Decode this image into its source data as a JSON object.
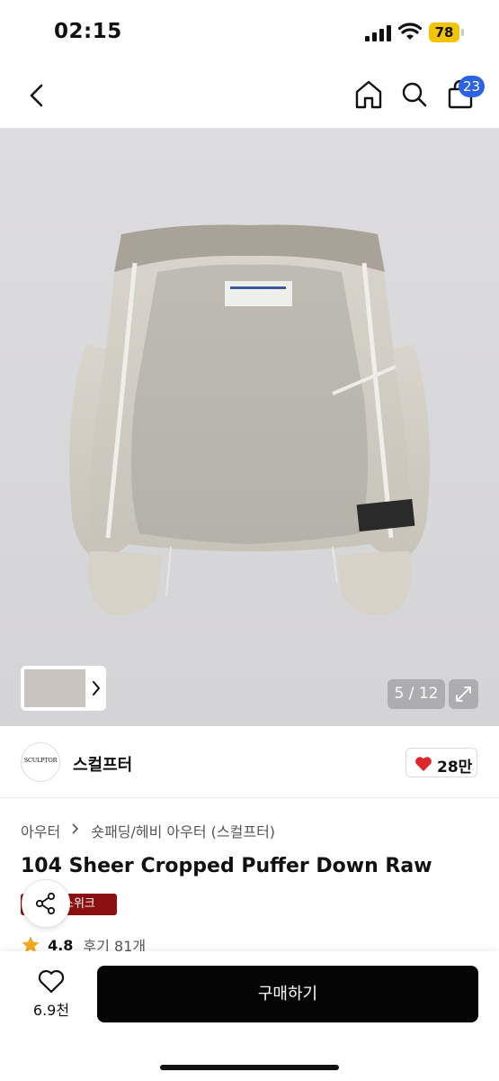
{
  "status_bar": {
    "time": "02:15",
    "battery_level": "78",
    "icons": [
      "signal-icon",
      "wifi-icon",
      "battery-icon"
    ]
  },
  "nav": {
    "icons": [
      "back-icon",
      "home-icon",
      "search-icon",
      "bag-icon"
    ],
    "cart_count": "23",
    "badge_color": "#2a63e6"
  },
  "gallery": {
    "page_indicator": "5 / 12",
    "icons": [
      "chevron-right-icon",
      "expand-icon"
    ]
  },
  "brand": {
    "logo_text": "SCULPTOR",
    "name": "스컬프터",
    "like_count": "28만",
    "heart_color": "#e0262d"
  },
  "breadcrumb": {
    "items": [
      "아우터",
      "숏패딩/헤비 아우터 (스컬프터)"
    ]
  },
  "product": {
    "title": "104 Sheer Cropped Puffer Down Raw",
    "promo_tag": "스위크",
    "promo_color": "#8b1010",
    "rating": "4.8",
    "reviews": "후기 81개"
  },
  "bottom_bar": {
    "wish_count": "6.9천",
    "buy_label": "구매하기"
  }
}
